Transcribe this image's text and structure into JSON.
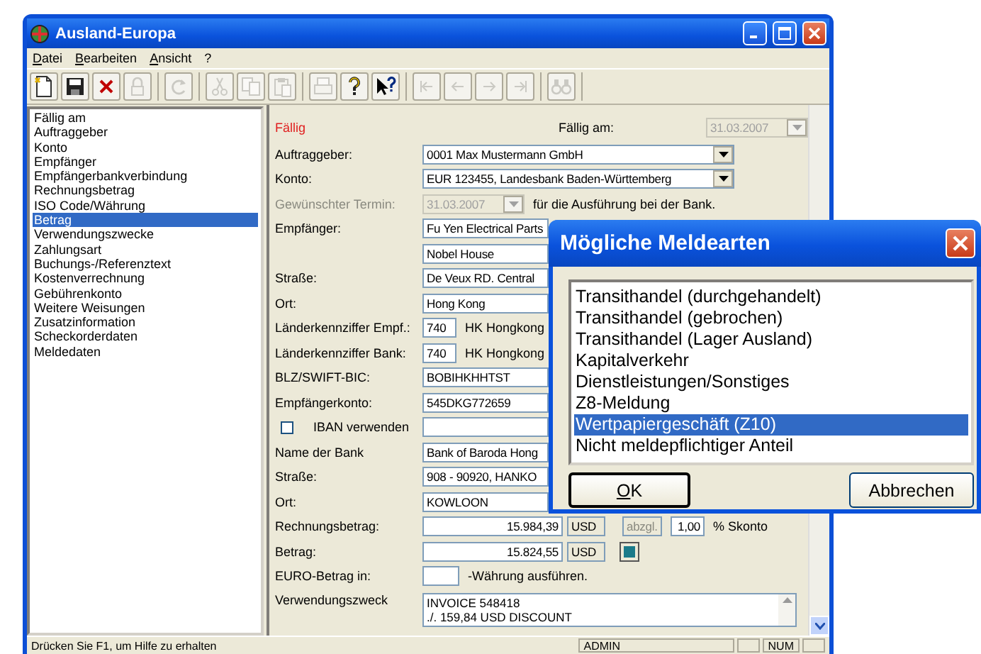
{
  "window": {
    "title": "Ausland-Europa"
  },
  "menu": [
    "Datei",
    "Bearbeiten",
    "Ansicht",
    "?"
  ],
  "toolbar": [
    [
      {
        "kind": "new",
        "disabled": false
      },
      {
        "kind": "save",
        "disabled": false
      },
      {
        "kind": "delete",
        "disabled": false
      },
      {
        "kind": "lock",
        "disabled": true
      }
    ],
    [
      {
        "kind": "refresh",
        "disabled": true
      }
    ],
    [
      {
        "kind": "cut",
        "disabled": true
      },
      {
        "kind": "copy",
        "disabled": true
      },
      {
        "kind": "paste",
        "disabled": true
      }
    ],
    [
      {
        "kind": "print",
        "disabled": true
      },
      {
        "kind": "help",
        "disabled": false
      },
      {
        "kind": "context_help",
        "disabled": false
      }
    ],
    [
      {
        "kind": "first",
        "disabled": true
      },
      {
        "kind": "previous",
        "disabled": true
      },
      {
        "kind": "next",
        "disabled": true
      },
      {
        "kind": "last",
        "disabled": true
      }
    ],
    [
      {
        "kind": "find",
        "disabled": true
      }
    ]
  ],
  "sidebar": {
    "items": [
      {
        "label": "Fällig am",
        "selected": false
      },
      {
        "label": "Auftraggeber",
        "selected": false
      },
      {
        "label": "Konto",
        "selected": false
      },
      {
        "label": "Empfänger",
        "selected": false
      },
      {
        "label": "Empfängerbankverbindung",
        "selected": false
      },
      {
        "label": "Rechnungsbetrag",
        "selected": false
      },
      {
        "label": "ISO Code/Währung",
        "selected": false
      },
      {
        "label": "Betrag",
        "selected": true
      },
      {
        "label": "Verwendungszwecke",
        "selected": false
      },
      {
        "label": "Zahlungsart",
        "selected": false
      },
      {
        "label": "Buchungs-/Referenztext",
        "selected": false
      },
      {
        "label": "Kostenverrechnung",
        "selected": false
      },
      {
        "label": "Gebührenkonto",
        "selected": false
      },
      {
        "label": "Weitere Weisungen",
        "selected": false
      },
      {
        "label": "Zusatzinformation",
        "selected": false
      },
      {
        "label": "Scheckorderdaten",
        "selected": false
      },
      {
        "label": "Meldedaten",
        "selected": false
      }
    ]
  },
  "form": {
    "title": "Fällig",
    "due_label": "Fällig am:",
    "due_date": {
      "value": "31.03.2007",
      "disabled": true
    },
    "rows": [
      {
        "kind": "combo",
        "label": "Auftraggeber:",
        "value": "0001 Max Mustermann GmbH",
        "disabled": false
      },
      {
        "kind": "combo",
        "label": "Konto:",
        "value": "EUR 123455, Landesbank Baden-Württemberg",
        "disabled": false
      },
      {
        "kind": "date",
        "label": "Gewünschter Termin:",
        "value": "31.03.2007",
        "note": "für die Ausführung bei der Bank.",
        "disabled": true
      },
      {
        "kind": "text",
        "label": "Empfänger:",
        "value": "Fu Yen Electrical Parts",
        "disabled": false
      },
      {
        "kind": "text",
        "value": "Nobel House",
        "disabled": false
      },
      {
        "kind": "text",
        "label": "Straße:",
        "value": "De Veux RD. Central",
        "disabled": false
      },
      {
        "kind": "text",
        "label": "Ort:",
        "value": "Hong Kong",
        "disabled": false
      },
      {
        "kind": "code",
        "label": "Länderkennziffer Empf.:",
        "value": "740",
        "note": "HK Hongkong",
        "disabled": false
      },
      {
        "kind": "code",
        "label": "Länderkennziffer Bank:",
        "value": "740",
        "note": "HK Hongkong",
        "disabled": false
      },
      {
        "kind": "text",
        "label": "BLZ/SWIFT-BIC:",
        "value": "BOBIHKHHTST",
        "disabled": false
      },
      {
        "kind": "text",
        "label": "Empfängerkonto:",
        "value": "545DKG772659",
        "disabled": false
      },
      {
        "kind": "checkbox",
        "label": "IBAN verwenden",
        "checked": false,
        "disabled": false
      },
      {
        "kind": "text",
        "label": "Name der Bank",
        "value": "Bank of Baroda Hong",
        "disabled": false
      },
      {
        "kind": "text",
        "label": "Straße:",
        "value": "908 - 90920, HANKO",
        "disabled": false
      },
      {
        "kind": "text",
        "label": "Ort:",
        "value": "KOWLOON",
        "disabled": false
      },
      {
        "kind": "amount",
        "label": "Rechnungsbetrag:",
        "value": "15.984,39",
        "currency": "USD",
        "discount_label": "abzgl.",
        "discount": "1,00",
        "discount_unit": "% Skonto",
        "disabled": false
      },
      {
        "kind": "amount",
        "label": "Betrag:",
        "value": "15.824,55",
        "currency": "USD",
        "action": true,
        "disabled": false
      },
      {
        "kind": "currency",
        "label": "EURO-Betrag in:",
        "note": "-Währung ausführen.",
        "disabled": false
      },
      {
        "kind": "memo",
        "label": "Verwendungszweck",
        "lines": [
          "INVOICE 548418",
          "./. 159,84 USD DISCOUNT"
        ],
        "disabled": false
      }
    ]
  },
  "status_bar": {
    "text": "Drücken Sie F1, um Hilfe zu erhalten",
    "panels": [
      "ADMIN",
      "NUM"
    ]
  },
  "dialog": {
    "title": "Mögliche Meldearten",
    "items": [
      {
        "label": "Transithandel (durchgehandelt)",
        "selected": false
      },
      {
        "label": "Transithandel (gebrochen)",
        "selected": false
      },
      {
        "label": "Transithandel (Lager Ausland)",
        "selected": false
      },
      {
        "label": "Kapitalverkehr",
        "selected": false
      },
      {
        "label": "Dienstleistungen/Sonstiges",
        "selected": false
      },
      {
        "label": "Z8-Meldung",
        "selected": false
      },
      {
        "label": "Wertpapiergeschäft (Z10)",
        "selected": true
      },
      {
        "label": "Nicht meldepflichtiger Anteil",
        "selected": false
      }
    ],
    "buttons": [
      {
        "label": "OK",
        "default": true
      },
      {
        "label": "Abbrechen",
        "default": false
      }
    ]
  }
}
